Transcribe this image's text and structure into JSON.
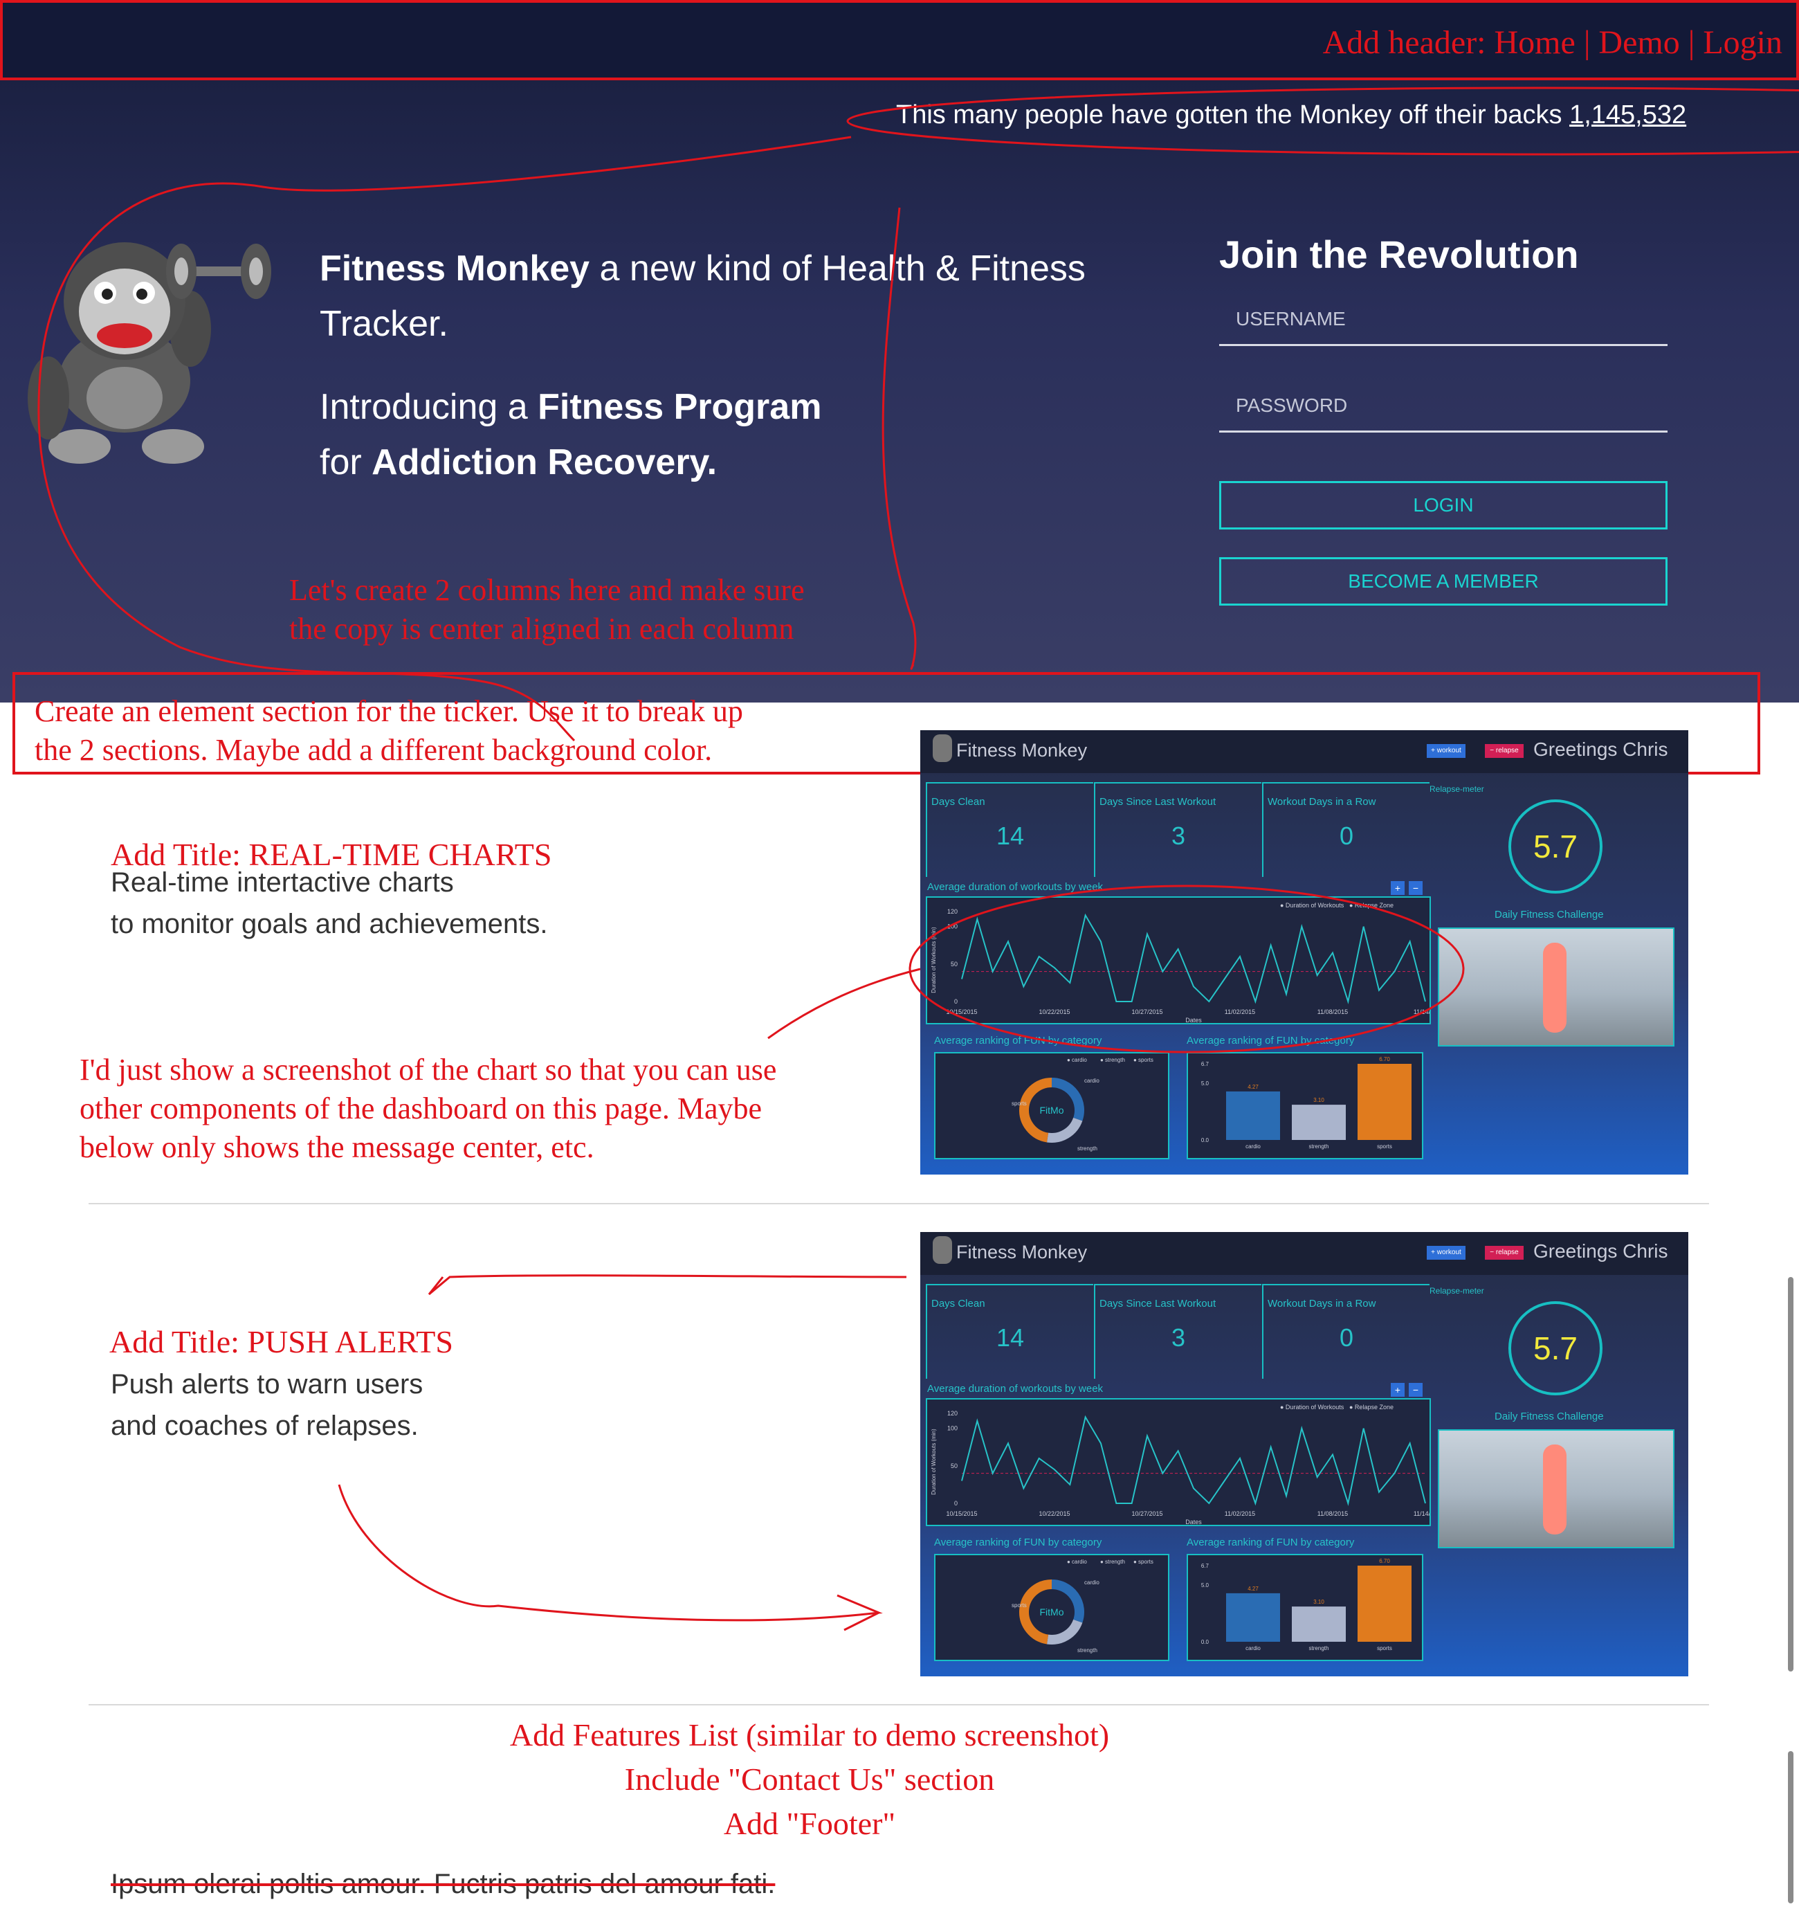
{
  "header": {
    "annotation": "Add header: Home | Demo | Login"
  },
  "ticker": {
    "text": "This many people have gotten the Monkey off their backs",
    "count": "1,145,532"
  },
  "hero": {
    "line1_bold": "Fitness Monkey",
    "line1_rest": " a new kind of Health & Fitness",
    "line2": "Tracker.",
    "line3_pre": "Introducing a ",
    "line3_bold": "Fitness Program",
    "line4_pre": "for ",
    "line4_bold": "Addiction Recovery."
  },
  "join": {
    "title": "Join the Revolution",
    "username_placeholder": "USERNAME",
    "password_placeholder": "PASSWORD",
    "login_label": "LOGIN",
    "member_label": "BECOME A MEMBER"
  },
  "annotations": {
    "columns_note_1": "Let's create 2 columns here and make sure",
    "columns_note_2": "the copy is center aligned in each column",
    "ticker_note_1": "Create an element section for the ticker. Use it to break up",
    "ticker_note_2": "the 2 sections. Maybe add a different background color.",
    "charts_title": "Add Title: REAL-TIME CHARTS",
    "screenshot_note_1": "I'd just show a screenshot of the chart so that you can use",
    "screenshot_note_2": "other components of the dashboard on this page. Maybe",
    "screenshot_note_3": "below only shows the message center, etc.",
    "alerts_title": "Add Title: PUSH ALERTS",
    "features_1": "Add Features List (similar to demo screenshot)",
    "features_2": "Include \"Contact Us\" section",
    "features_3": "Add \"Footer\""
  },
  "section_charts": {
    "line1": "Real-time intertactive charts",
    "line2": "to monitor goals and achievements."
  },
  "section_alerts": {
    "line1": "Push alerts to warn users",
    "line2": "and coaches of relapses."
  },
  "footer_text": "Ipsum olerai poltis amour. Fuctris patris del amour fati.",
  "dashboard": {
    "brand": "Fitness Monkey",
    "workout_btn": "+ workout",
    "relapse_btn": "− relapse",
    "greeting": "Greetings Chris",
    "days_clean_label": "Days Clean",
    "days_clean": "14",
    "days_since_label": "Days Since Last Workout",
    "days_since": "3",
    "in_row_label": "Workout Days in a Row",
    "in_row": "0",
    "relapse_meter_label": "Relapse-meter",
    "relapse_meter": "5.7",
    "avg_duration_label": "Average duration of workouts by week",
    "challenge_label": "Daily Fitness Challenge",
    "fun_label_1": "Average ranking of FUN by category",
    "fun_label_2": "Average ranking of FUN by category",
    "legend_duration": "Duration of Workouts",
    "legend_relapse": "Relapse Zone",
    "ylabel": "Duration of Workouts (min)",
    "xlabel": "Dates",
    "x_ticks": [
      "10/15/2015",
      "10/22/2015",
      "10/27/2015",
      "11/02/2015",
      "11/08/2015",
      "11/14/20"
    ],
    "y_ticks": [
      "120",
      "100",
      "50",
      "0"
    ],
    "donut_center": "FitMo",
    "donut_labels": [
      "cardio",
      "sports",
      "strength"
    ],
    "legend_categories": [
      "cardio",
      "strength",
      "sports"
    ],
    "bar_values_text": [
      "4.27",
      "3.10",
      "6.70"
    ],
    "bar_y_ticks": [
      "6.7",
      "5.0",
      "0.0"
    ],
    "plus": "+",
    "minus": "−"
  },
  "chart_data": {
    "type": "bar",
    "title": "Average ranking of FUN by category",
    "categories": [
      "cardio",
      "strength",
      "sports"
    ],
    "values": [
      4.27,
      3.1,
      6.7
    ],
    "colors": [
      "#2a6cb3",
      "#aab4cc",
      "#e07b1e"
    ],
    "ylim": [
      0,
      6.7
    ]
  },
  "line_chart_data": {
    "type": "line",
    "series": [
      {
        "name": "Duration of Workouts",
        "values": [
          30,
          110,
          40,
          80,
          20,
          60,
          45,
          25,
          115,
          80,
          0,
          0,
          90,
          40,
          70,
          20,
          0,
          30,
          60,
          0,
          75,
          10,
          100,
          35,
          65,
          0,
          100,
          15,
          40,
          80,
          0
        ]
      }
    ],
    "relapse_zone": 40
  }
}
